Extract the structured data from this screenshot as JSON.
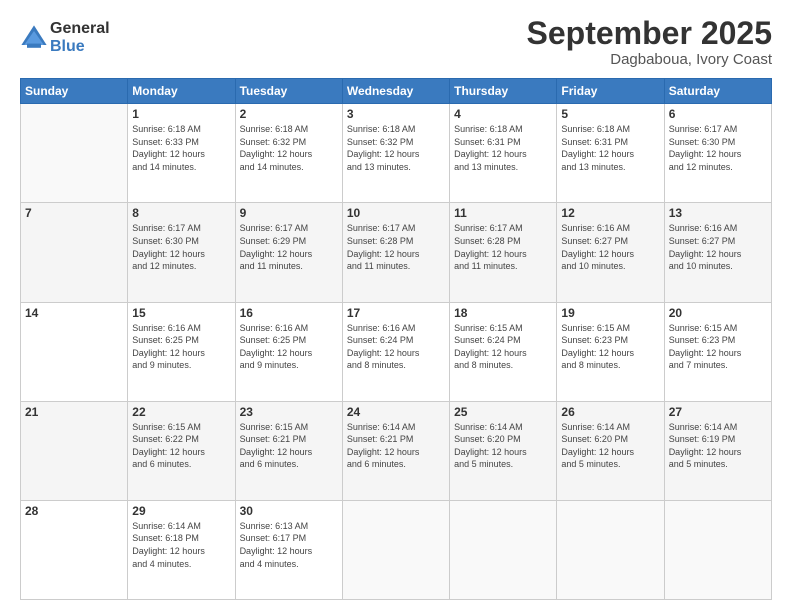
{
  "logo": {
    "general": "General",
    "blue": "Blue"
  },
  "header": {
    "month": "September 2025",
    "location": "Dagbaboua, Ivory Coast"
  },
  "weekdays": [
    "Sunday",
    "Monday",
    "Tuesday",
    "Wednesday",
    "Thursday",
    "Friday",
    "Saturday"
  ],
  "days": [
    {
      "num": "",
      "info": ""
    },
    {
      "num": "1",
      "info": "Sunrise: 6:18 AM\nSunset: 6:33 PM\nDaylight: 12 hours\nand 14 minutes."
    },
    {
      "num": "2",
      "info": "Sunrise: 6:18 AM\nSunset: 6:32 PM\nDaylight: 12 hours\nand 14 minutes."
    },
    {
      "num": "3",
      "info": "Sunrise: 6:18 AM\nSunset: 6:32 PM\nDaylight: 12 hours\nand 13 minutes."
    },
    {
      "num": "4",
      "info": "Sunrise: 6:18 AM\nSunset: 6:31 PM\nDaylight: 12 hours\nand 13 minutes."
    },
    {
      "num": "5",
      "info": "Sunrise: 6:18 AM\nSunset: 6:31 PM\nDaylight: 12 hours\nand 13 minutes."
    },
    {
      "num": "6",
      "info": "Sunrise: 6:17 AM\nSunset: 6:30 PM\nDaylight: 12 hours\nand 12 minutes."
    },
    {
      "num": "7",
      "info": ""
    },
    {
      "num": "8",
      "info": "Sunrise: 6:17 AM\nSunset: 6:30 PM\nDaylight: 12 hours\nand 12 minutes."
    },
    {
      "num": "9",
      "info": "Sunrise: 6:17 AM\nSunset: 6:29 PM\nDaylight: 12 hours\nand 11 minutes."
    },
    {
      "num": "10",
      "info": "Sunrise: 6:17 AM\nSunset: 6:28 PM\nDaylight: 12 hours\nand 11 minutes."
    },
    {
      "num": "11",
      "info": "Sunrise: 6:17 AM\nSunset: 6:28 PM\nDaylight: 12 hours\nand 11 minutes."
    },
    {
      "num": "12",
      "info": "Sunrise: 6:16 AM\nSunset: 6:27 PM\nDaylight: 12 hours\nand 10 minutes."
    },
    {
      "num": "13",
      "info": "Sunrise: 6:16 AM\nSunset: 6:27 PM\nDaylight: 12 hours\nand 10 minutes."
    },
    {
      "num": "14",
      "info": ""
    },
    {
      "num": "15",
      "info": "Sunrise: 6:16 AM\nSunset: 6:25 PM\nDaylight: 12 hours\nand 9 minutes."
    },
    {
      "num": "16",
      "info": "Sunrise: 6:16 AM\nSunset: 6:25 PM\nDaylight: 12 hours\nand 9 minutes."
    },
    {
      "num": "17",
      "info": "Sunrise: 6:16 AM\nSunset: 6:24 PM\nDaylight: 12 hours\nand 8 minutes."
    },
    {
      "num": "18",
      "info": "Sunrise: 6:15 AM\nSunset: 6:24 PM\nDaylight: 12 hours\nand 8 minutes."
    },
    {
      "num": "19",
      "info": "Sunrise: 6:15 AM\nSunset: 6:23 PM\nDaylight: 12 hours\nand 8 minutes."
    },
    {
      "num": "20",
      "info": "Sunrise: 6:15 AM\nSunset: 6:23 PM\nDaylight: 12 hours\nand 7 minutes."
    },
    {
      "num": "21",
      "info": ""
    },
    {
      "num": "22",
      "info": "Sunrise: 6:15 AM\nSunset: 6:22 PM\nDaylight: 12 hours\nand 6 minutes."
    },
    {
      "num": "23",
      "info": "Sunrise: 6:15 AM\nSunset: 6:21 PM\nDaylight: 12 hours\nand 6 minutes."
    },
    {
      "num": "24",
      "info": "Sunrise: 6:14 AM\nSunset: 6:21 PM\nDaylight: 12 hours\nand 6 minutes."
    },
    {
      "num": "25",
      "info": "Sunrise: 6:14 AM\nSunset: 6:20 PM\nDaylight: 12 hours\nand 5 minutes."
    },
    {
      "num": "26",
      "info": "Sunrise: 6:14 AM\nSunset: 6:20 PM\nDaylight: 12 hours\nand 5 minutes."
    },
    {
      "num": "27",
      "info": "Sunrise: 6:14 AM\nSunset: 6:19 PM\nDaylight: 12 hours\nand 5 minutes."
    },
    {
      "num": "28",
      "info": ""
    },
    {
      "num": "29",
      "info": "Sunrise: 6:14 AM\nSunset: 6:18 PM\nDaylight: 12 hours\nand 4 minutes."
    },
    {
      "num": "30",
      "info": "Sunrise: 6:13 AM\nSunset: 6:17 PM\nDaylight: 12 hours\nand 4 minutes."
    },
    {
      "num": "",
      "info": ""
    },
    {
      "num": "",
      "info": ""
    },
    {
      "num": "",
      "info": ""
    },
    {
      "num": "",
      "info": ""
    }
  ]
}
